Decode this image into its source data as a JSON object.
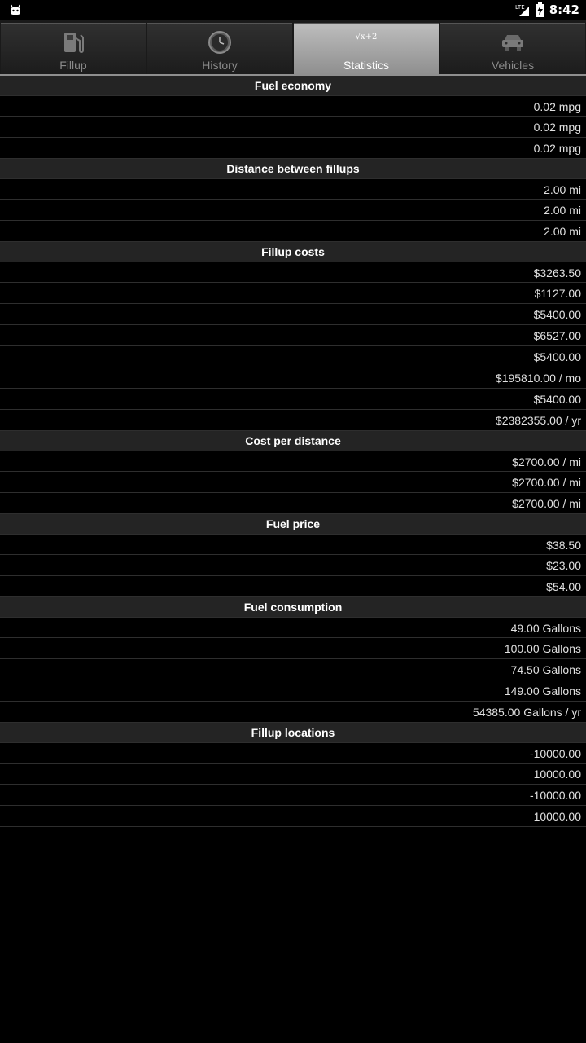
{
  "status_bar": {
    "network": "LTE",
    "time": "8:42"
  },
  "tabs": [
    {
      "label": "Fillup",
      "icon": "fuel-pump-icon",
      "active": false
    },
    {
      "label": "History",
      "icon": "clock-icon",
      "active": false
    },
    {
      "label": "Statistics",
      "icon": "formula-icon",
      "icon_text": "√x+2",
      "active": true
    },
    {
      "label": "Vehicles",
      "icon": "car-icon",
      "active": false
    }
  ],
  "sections": [
    {
      "title": "Fuel economy",
      "values": [
        "0.02 mpg",
        "0.02 mpg",
        "0.02 mpg"
      ]
    },
    {
      "title": "Distance between fillups",
      "values": [
        "2.00 mi",
        "2.00 mi",
        "2.00 mi"
      ]
    },
    {
      "title": "Fillup costs",
      "values": [
        "$3263.50",
        "$1127.00",
        "$5400.00",
        "$6527.00",
        "$5400.00",
        "$195810.00 / mo",
        "$5400.00",
        "$2382355.00 / yr"
      ]
    },
    {
      "title": "Cost per distance",
      "values": [
        "$2700.00 / mi",
        "$2700.00 / mi",
        "$2700.00 / mi"
      ]
    },
    {
      "title": "Fuel price",
      "values": [
        "$38.50",
        "$23.00",
        "$54.00"
      ]
    },
    {
      "title": "Fuel consumption",
      "values": [
        "49.00 Gallons",
        "100.00 Gallons",
        "74.50 Gallons",
        "149.00 Gallons",
        "54385.00 Gallons / yr"
      ]
    },
    {
      "title": "Fillup locations",
      "values": [
        "-10000.00",
        "10000.00",
        "-10000.00",
        "10000.00"
      ]
    }
  ]
}
